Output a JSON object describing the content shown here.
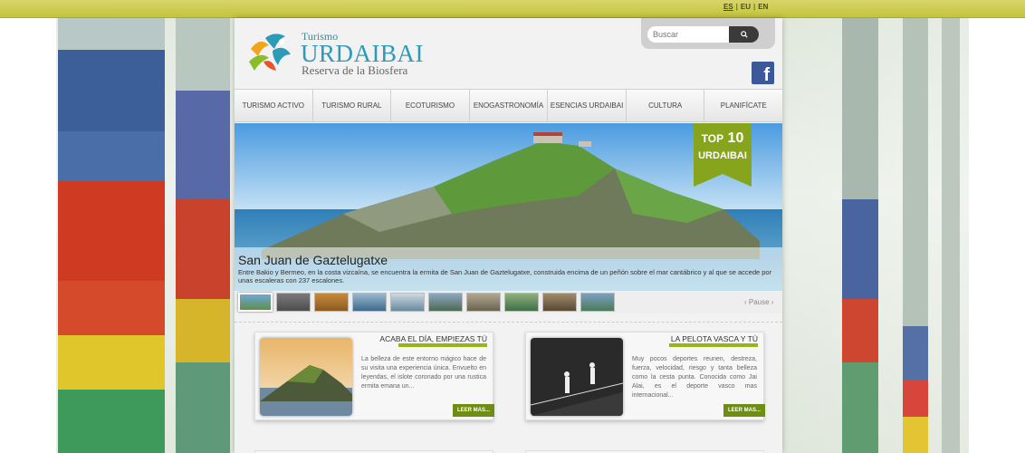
{
  "languages": [
    {
      "code": "ES",
      "active": true
    },
    {
      "code": "EU",
      "active": false
    },
    {
      "code": "EN",
      "active": false
    }
  ],
  "logo": {
    "small": "Turismo",
    "big": "URDAIBAI",
    "sub": "Reserva de la Biosfera"
  },
  "search": {
    "placeholder": "Buscar",
    "button_icon": "search-icon"
  },
  "social": {
    "facebook_glyph": "f"
  },
  "nav": [
    "TURISMO ACTIVO",
    "TURISMO RURAL",
    "ECOTURISMO",
    "ENOGASTRONOMÍA",
    "ESENCIAS URDAIBAI",
    "CULTURA",
    "PLANIFÍCATE"
  ],
  "slider": {
    "badge_line1": "TOP",
    "badge_line1_num": "10",
    "badge_line2": "URDAIBAI",
    "title": "San Juan de Gaztelugatxe",
    "text": "Entre Bakio y Bermeo, en la costa vizcaína, se encuentra la ermita de San Juan de Gaztelugatxe, construida encima de un peñón sobre el mar cantábrico y al que se accede por unas escaleras con 237 escalones.",
    "pause_label": "‹ Pause ›",
    "thumb_count": 10
  },
  "cards": [
    {
      "title": "ACABA EL DÍA, EMPIEZAS TÚ",
      "text": "La belleza de este entorno mágico hace de su visita una experiencia única. Envuelto en leyendas, el islote coronado por una rustica ermita emana un...",
      "button": "LEER MAS..."
    },
    {
      "title": "LA PELOTA VASCA Y TÚ",
      "text": "Muy pocos deportes reunen, destreza, fuerza, velocidad, riesgo y tanta belleza como la cesta punta. Conocida como Jai Alai, es el deporte vasco mas internacional...",
      "button": "LEER MAS..."
    }
  ],
  "colors": {
    "topbar": "#c4c43c",
    "accent_green": "#9bb319",
    "button_green": "#6f8c14",
    "logo_blue": "#2d9ab8"
  }
}
